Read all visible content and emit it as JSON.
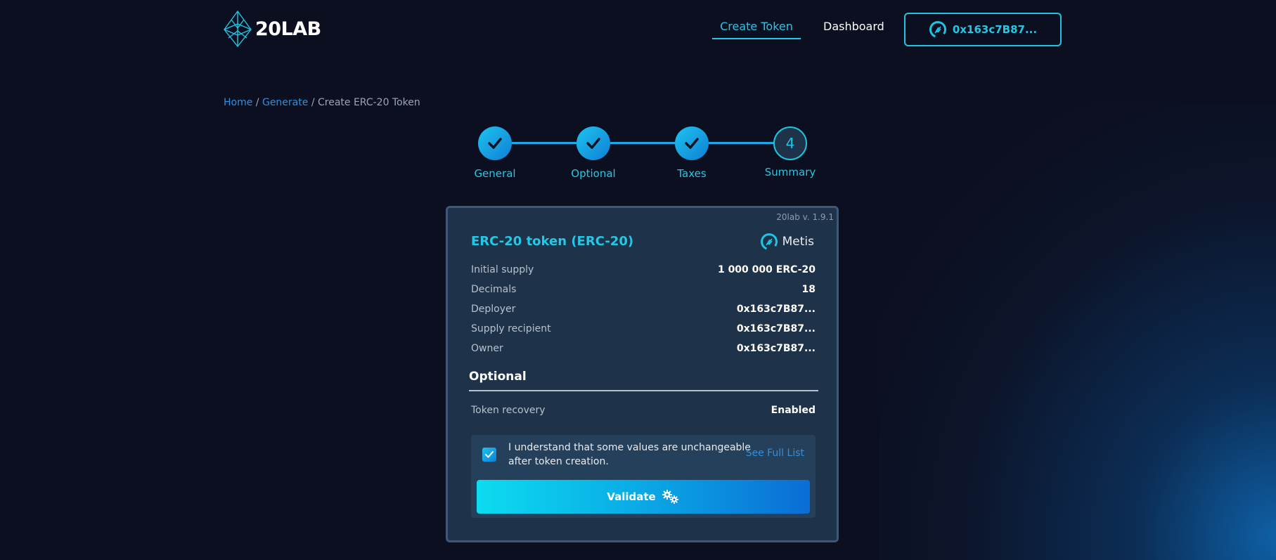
{
  "header": {
    "brand": "20LAB",
    "nav": {
      "create_token": "Create Token",
      "dashboard": "Dashboard"
    },
    "wallet_address": "0x163c7B87..."
  },
  "breadcrumb": {
    "home": "Home",
    "generate": "Generate",
    "current": "Create ERC-20 Token"
  },
  "stepper": {
    "steps": [
      {
        "label": "General",
        "state": "done"
      },
      {
        "label": "Optional",
        "state": "done"
      },
      {
        "label": "Taxes",
        "state": "done"
      },
      {
        "label": "Summary",
        "state": "active",
        "number": "4"
      }
    ]
  },
  "card": {
    "version": "20lab v. 1.9.1",
    "title": "ERC-20 token (ERC-20)",
    "network": "Metis",
    "rows": [
      {
        "label": "Initial supply",
        "value": "1 000 000 ERC-20"
      },
      {
        "label": "Decimals",
        "value": "18"
      },
      {
        "label": "Deployer",
        "value": "0x163c7B87..."
      },
      {
        "label": "Supply recipient",
        "value": "0x163c7B87..."
      },
      {
        "label": "Owner",
        "value": "0x163c7B87..."
      }
    ],
    "optional_title": "Optional",
    "optional_rows": [
      {
        "label": "Token recovery",
        "value": "Enabled"
      }
    ],
    "confirm_text": "I understand that some values are unchangeable after token creation.",
    "see_full_list": "See Full List",
    "checkbox_checked": true,
    "validate_label": "Validate"
  },
  "colors": {
    "accent": "#23c8e6",
    "link": "#2f8fe0",
    "background": "#0c0f1f",
    "card": "#1e3349"
  }
}
